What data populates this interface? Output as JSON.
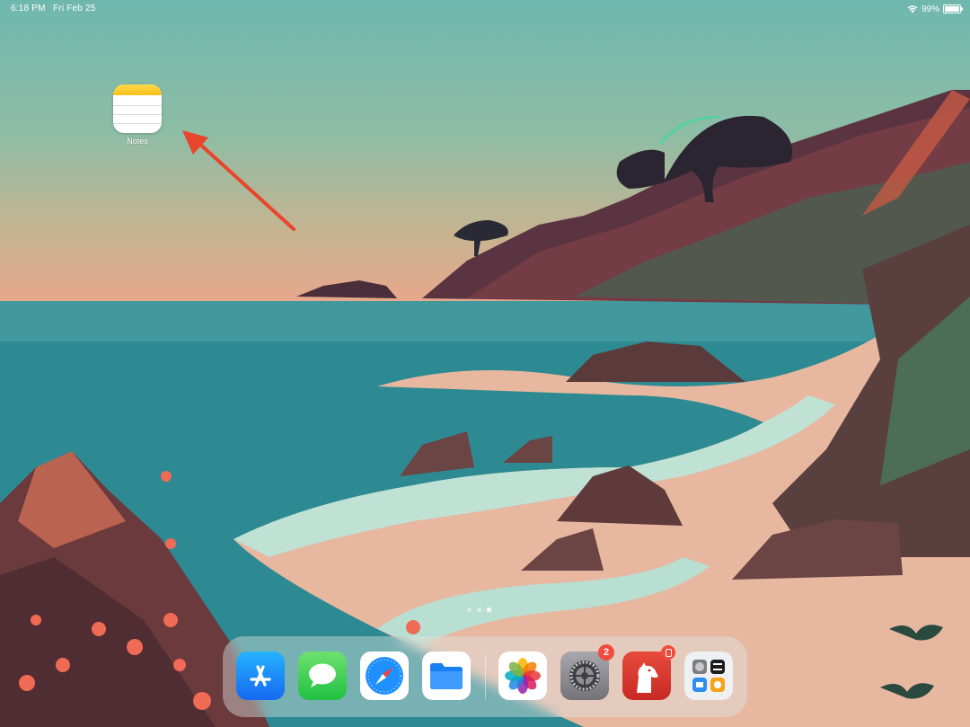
{
  "status_bar": {
    "time": "6:18 PM",
    "date": "Fri Feb 25",
    "battery_text": "99%",
    "battery_level": 0.99,
    "wifi_icon": "wifi-icon"
  },
  "home_apps": [
    {
      "label": "Notes",
      "icon": "notes-icon"
    }
  ],
  "annotation": {
    "arrow_color": "#e8452c"
  },
  "page_indicator": {
    "total": 3,
    "current": 3
  },
  "dock": {
    "apps": [
      {
        "name": "App Store",
        "icon": "app-store-icon",
        "color": "#1a8cff"
      },
      {
        "name": "Messages",
        "icon": "messages-icon",
        "color": "#34c759"
      },
      {
        "name": "Safari",
        "icon": "safari-icon",
        "color": "#1e90ff"
      },
      {
        "name": "Files",
        "icon": "files-icon",
        "color": "#1a7ff0"
      },
      {
        "name": "Photos",
        "icon": "photos-icon",
        "color": "#ffffff"
      },
      {
        "name": "Settings",
        "icon": "settings-gear-icon",
        "color": "#8e8e93",
        "badge": "2"
      },
      {
        "name": "Bear",
        "icon": "bear-icon",
        "color": "#d9342b",
        "badge": ""
      },
      {
        "name": "App Library",
        "icon": "app-library-icon",
        "color": "#eef0f2"
      }
    ]
  }
}
